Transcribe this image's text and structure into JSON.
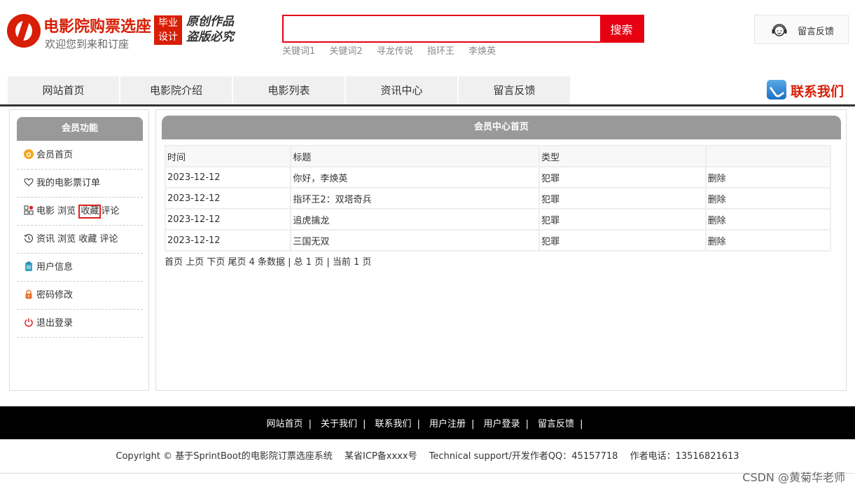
{
  "header": {
    "site_title": "电影院购票选座",
    "site_subtitle": "欢迎您到来和订座",
    "badge_line1": "毕业",
    "badge_line2": "设计",
    "slogan_line1": "原创作品",
    "slogan_line2": "盗版必究",
    "search": {
      "value": "",
      "placeholder": "",
      "button_label": "搜索"
    },
    "hot_keywords": [
      "关键词1",
      "关键词2",
      "寻龙传说",
      "指环王",
      "李焕英"
    ],
    "feedback_label": "留言反馈"
  },
  "nav": {
    "items": [
      "网站首页",
      "电影院介绍",
      "电影列表",
      "资讯中心",
      "留言反馈"
    ],
    "contact_label": "联系我们"
  },
  "sidebar": {
    "title": "会员功能",
    "items": [
      {
        "label": "会员首页",
        "icon": "home-icon"
      },
      {
        "label": "我的电影票订单",
        "icon": "heart-icon"
      },
      {
        "label_parts": [
          "电影",
          "浏览",
          "收藏",
          "评论"
        ],
        "icon": "grid-icon"
      },
      {
        "label_parts": [
          "资讯",
          "浏览",
          "收藏",
          "评论"
        ],
        "icon": "history-icon"
      },
      {
        "label": "用户信息",
        "icon": "clipboard-icon"
      },
      {
        "label": "密码修改",
        "icon": "lock-icon"
      },
      {
        "label": "退出登录",
        "icon": "power-icon"
      }
    ]
  },
  "main": {
    "title": "会员中心首页",
    "columns": [
      "时间",
      "标题",
      "类型",
      ""
    ],
    "rows": [
      {
        "time": "2023-12-12",
        "title": "你好，李焕英",
        "type": "犯罪",
        "action": "删除"
      },
      {
        "time": "2023-12-12",
        "title": "指环王2：双塔奇兵",
        "type": "犯罪",
        "action": "删除"
      },
      {
        "time": "2023-12-12",
        "title": "追虎擒龙",
        "type": "犯罪",
        "action": "删除"
      },
      {
        "time": "2023-12-12",
        "title": "三国无双",
        "type": "犯罪",
        "action": "删除"
      }
    ],
    "pager": {
      "first": "首页",
      "prev": "上页",
      "next": "下页",
      "last": "尾页",
      "summary": "4 条数据 | 总 1 页 | 当前 1 页"
    }
  },
  "footer": {
    "links": [
      "网站首页",
      "关于我们",
      "联系我们",
      "用户注册",
      "用户登录",
      "留言反馈"
    ],
    "separator": "|",
    "copyright": "Copyright © 基于SprintBoot的电影院订票选座系统　 某省ICP备xxxx号 　Technical support/开发作者QQ：45157718　 作者电话：13516821613",
    "watermark": "CSDN @黄菊华老师"
  },
  "colors": {
    "brand_red": "#d81e06",
    "search_red": "#e60012",
    "panel_gray": "#999999",
    "footer_black": "#000000"
  }
}
